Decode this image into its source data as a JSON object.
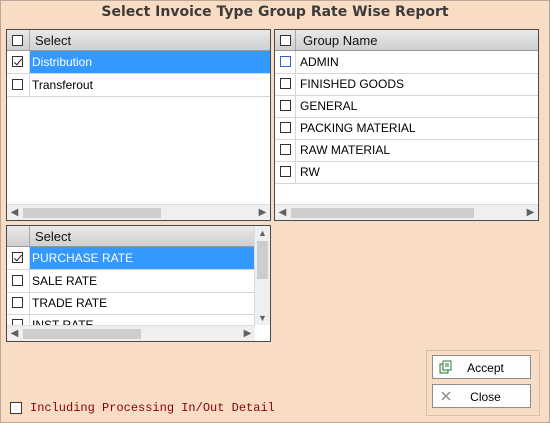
{
  "window": {
    "title": "Select Invoice Type Group Rate Wise Report"
  },
  "invoice_grid": {
    "header": "Select",
    "rows": [
      {
        "label": "Distribution",
        "checked": true,
        "selected": true
      },
      {
        "label": "Transferout",
        "checked": false,
        "selected": false
      }
    ]
  },
  "group_grid": {
    "header": "Group Name",
    "rows": [
      {
        "label": "ADMIN",
        "checked": false
      },
      {
        "label": "FINISHED GOODS",
        "checked": false
      },
      {
        "label": "GENERAL",
        "checked": false
      },
      {
        "label": "PACKING MATERIAL",
        "checked": false
      },
      {
        "label": "RAW MATERIAL",
        "checked": false
      },
      {
        "label": "RW",
        "checked": false
      }
    ]
  },
  "rate_grid": {
    "header": "Select",
    "rows": [
      {
        "label": "PURCHASE RATE",
        "checked": true,
        "selected": true
      },
      {
        "label": "SALE RATE",
        "checked": false
      },
      {
        "label": "TRADE RATE",
        "checked": false
      },
      {
        "label": "INST RATE",
        "checked": false
      }
    ]
  },
  "buttons": {
    "accept": "Accept",
    "close": "Close"
  },
  "options": {
    "including_processing": "Including Processing In/Out Detail"
  },
  "colors": {
    "background": "#f9dcc4",
    "selection": "#3399ff",
    "option_text": "#8b0000"
  },
  "icons": {
    "accept": "accept-icon",
    "close": "close-x-icon"
  }
}
